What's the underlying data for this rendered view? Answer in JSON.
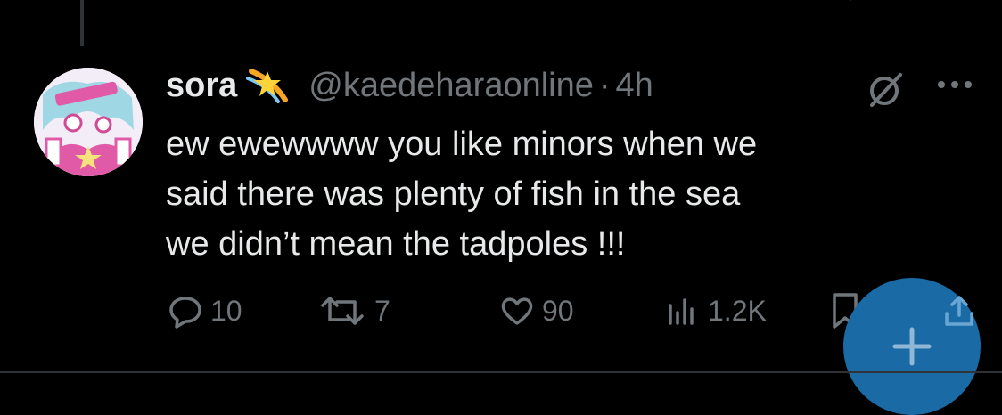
{
  "tweet": {
    "display_name": "sora",
    "name_emoji_icon": "shooting-star-emoji",
    "handle": "@kaedeharaonline",
    "separator": "·",
    "time": "4h",
    "text_lines": [
      "ew ewewwww you like minors when we",
      "said there was plenty of fish in the sea",
      "we didn’t mean the tadpoles !!!"
    ]
  },
  "actions": {
    "replies": "10",
    "reposts": "7",
    "likes": "90",
    "views": "1.2K"
  },
  "colors": {
    "background": "#000000",
    "text": "#e7e9ea",
    "muted": "#71767b",
    "fab": "#1a6aa6",
    "accent_pink": "#e05aa8"
  }
}
